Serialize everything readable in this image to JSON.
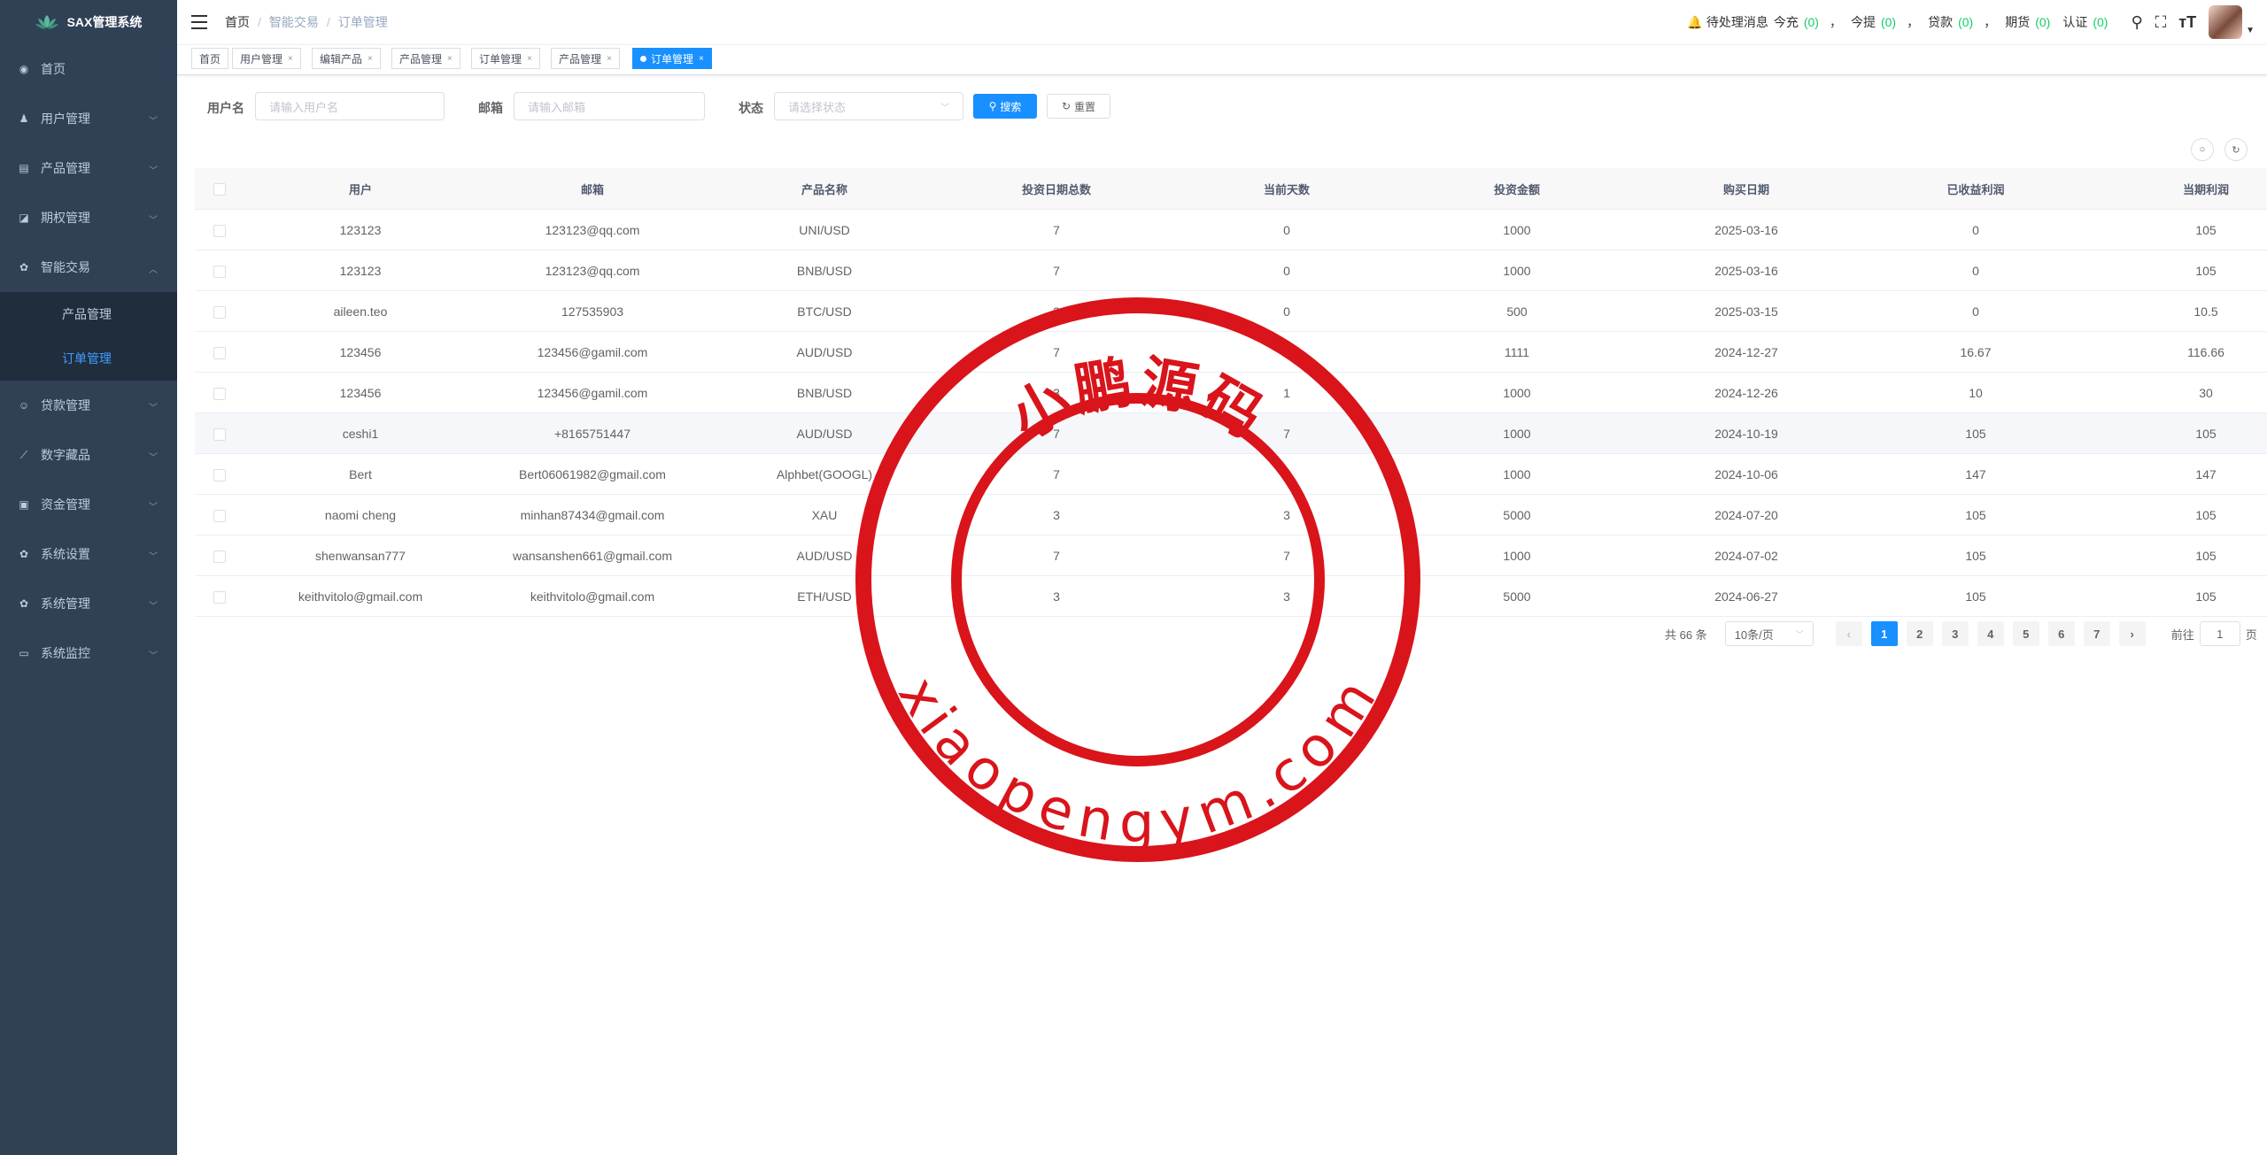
{
  "app": {
    "name": "SAX管理系统"
  },
  "sidebar": {
    "items": [
      {
        "label": "首页",
        "icon": "dashboard-icon"
      },
      {
        "label": "用户管理",
        "icon": "users-icon"
      },
      {
        "label": "产品管理",
        "icon": "document-icon"
      },
      {
        "label": "期权管理",
        "icon": "chart-icon"
      },
      {
        "label": "智能交易",
        "icon": "gear-icon"
      },
      {
        "label": "贷款管理",
        "icon": "loan-icon"
      },
      {
        "label": "数字藏品",
        "icon": "trend-icon"
      },
      {
        "label": "资金管理",
        "icon": "wallet-icon"
      },
      {
        "label": "系统设置",
        "icon": "gear-icon"
      },
      {
        "label": "系统管理",
        "icon": "gear-icon"
      },
      {
        "label": "系统监控",
        "icon": "monitor-icon"
      }
    ],
    "submenu": [
      {
        "label": "产品管理"
      },
      {
        "label": "订单管理"
      }
    ]
  },
  "breadcrumb": {
    "home": "首页",
    "section": "智能交易",
    "current": "订单管理"
  },
  "header": {
    "pending_label": "待处理消息",
    "recharge_label": "今充",
    "recharge_count": "(0)",
    "withdraw_label": "今提",
    "withdraw_count": "(0)",
    "loan_label": "贷款",
    "loan_count": "(0)",
    "futures_label": "期货",
    "futures_count": "(0)",
    "auth_label": "认证",
    "auth_count": "(0)",
    "sep": "，"
  },
  "tags": [
    {
      "label": "首页"
    },
    {
      "label": "用户管理"
    },
    {
      "label": "编辑产品"
    },
    {
      "label": "产品管理"
    },
    {
      "label": "订单管理"
    },
    {
      "label": "产品管理"
    },
    {
      "label": "订单管理",
      "active": true
    }
  ],
  "search": {
    "username_label": "用户名",
    "username_placeholder": "请输入用户名",
    "email_label": "邮箱",
    "email_placeholder": "请输入邮箱",
    "status_label": "状态",
    "status_placeholder": "请选择状态",
    "search_btn": "搜索",
    "reset_btn": "重置"
  },
  "table": {
    "columns": [
      "用户",
      "邮箱",
      "产品名称",
      "投资日期总数",
      "当前天数",
      "投资金额",
      "购买日期",
      "已收益利润",
      "当期利润"
    ],
    "rows": [
      [
        "123123",
        "123123@qq.com",
        "UNI/USD",
        "7",
        "0",
        "1000",
        "2025-03-16",
        "0",
        "105"
      ],
      [
        "123123",
        "123123@qq.com",
        "BNB/USD",
        "7",
        "0",
        "1000",
        "2025-03-16",
        "0",
        "105"
      ],
      [
        "aileen.teo",
        "127535903",
        "BTC/USD",
        "3",
        "0",
        "500",
        "2025-03-15",
        "0",
        "10.5"
      ],
      [
        "123456",
        "123456@gamil.com",
        "AUD/USD",
        "7",
        "1",
        "1111",
        "2024-12-27",
        "16.67",
        "116.66"
      ],
      [
        "123456",
        "123456@gamil.com",
        "BNB/USD",
        "3",
        "1",
        "1000",
        "2024-12-26",
        "10",
        "30"
      ],
      [
        "ceshi1",
        "+8165751447",
        "AUD/USD",
        "7",
        "7",
        "1000",
        "2024-10-19",
        "105",
        "105"
      ],
      [
        "Bert",
        "Bert06061982@gmail.com",
        "Alphbet(GOOGL)",
        "7",
        "7",
        "1000",
        "2024-10-06",
        "147",
        "147"
      ],
      [
        "naomi cheng",
        "minhan87434@gmail.com",
        "XAU",
        "3",
        "3",
        "5000",
        "2024-07-20",
        "105",
        "105"
      ],
      [
        "shenwansan777",
        "wansanshen661@gmail.com",
        "AUD/USD",
        "7",
        "7",
        "1000",
        "2024-07-02",
        "105",
        "105"
      ],
      [
        "keithvitolo@gmail.com",
        "keithvitolo@gmail.com",
        "ETH/USD",
        "3",
        "3",
        "5000",
        "2024-06-27",
        "105",
        "105"
      ]
    ]
  },
  "pagination": {
    "total": "共 66 条",
    "page_size": "10条/页",
    "pages": [
      "1",
      "2",
      "3",
      "4",
      "5",
      "6",
      "7"
    ],
    "current_page": "1",
    "goto_label": "前往",
    "goto_value": "1",
    "page_suffix": "页"
  },
  "watermark": {
    "top_text": "小鹏源码",
    "bottom_text": "xiaopengym.com",
    "color": "#d9141b"
  }
}
